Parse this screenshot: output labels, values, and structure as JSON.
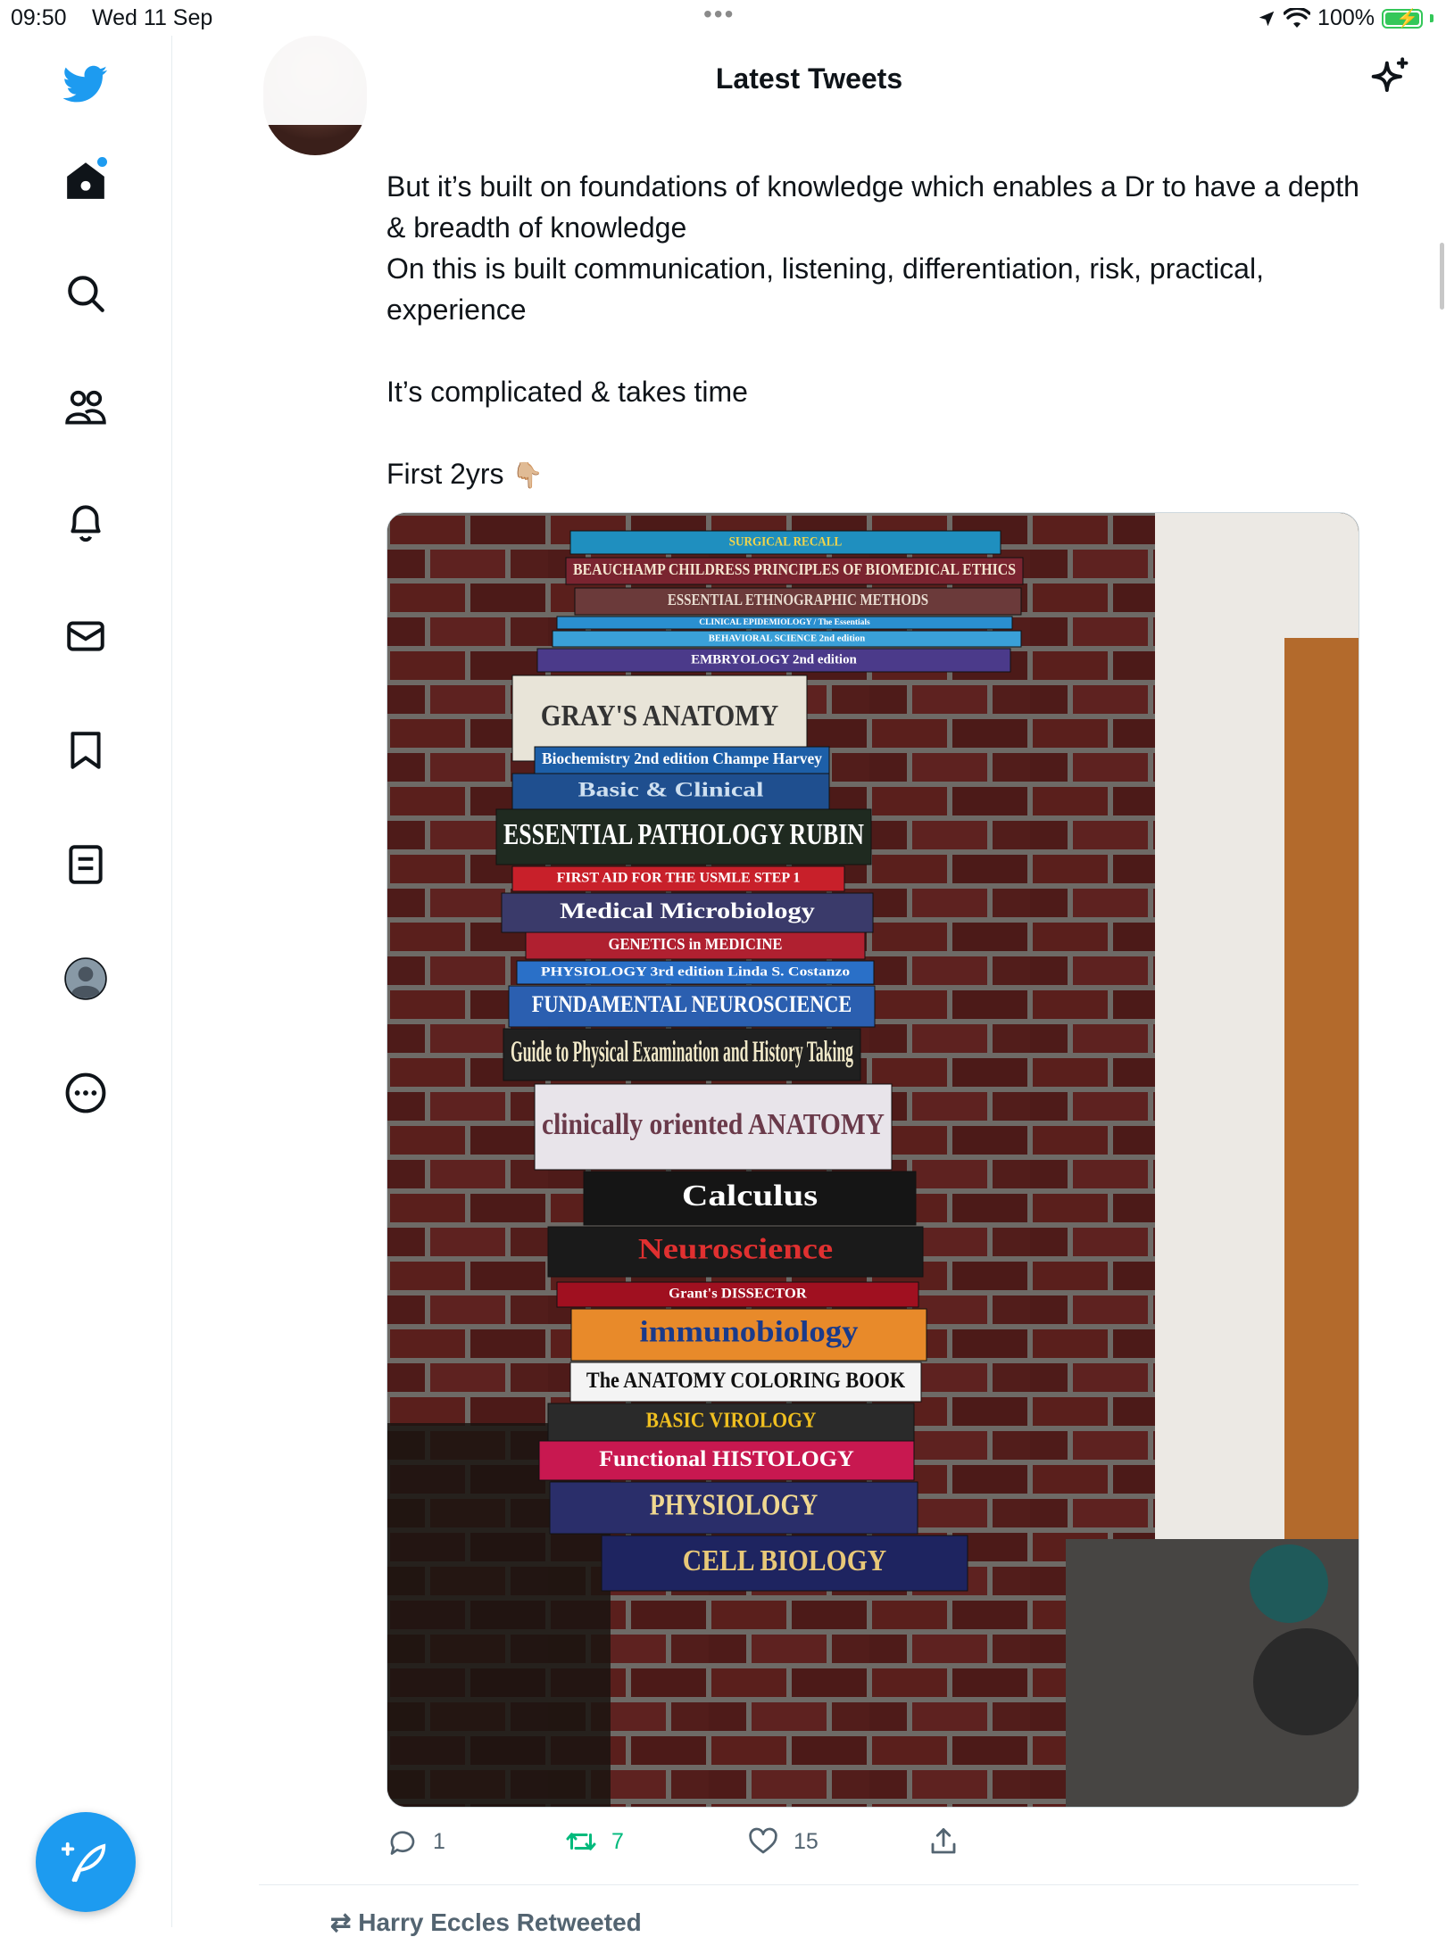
{
  "status_bar": {
    "time": "09:50",
    "date": "Wed 11 Sep",
    "battery": "100%"
  },
  "header": {
    "title": "Latest Tweets"
  },
  "tweet": {
    "text": "But it’s built on foundations of knowledge which enables a Dr to have a depth & breadth of knowledge\nOn this is built communication, listening, differentiation, risk, practical, experience\n\nIt’s complicated & takes time\n\nFirst 2yrs ",
    "emoji": "👇🏼",
    "reply_count": "1",
    "retweet_count": "7",
    "like_count": "15"
  },
  "books": [
    {
      "title": "SURGICAL RECALL",
      "color": "#1f8fbf",
      "text_color": "#f2d44a"
    },
    {
      "title": "BEAUCHAMP CHILDRESS  PRINCIPLES OF BIOMEDICAL ETHICS",
      "color": "#7a2430",
      "text_color": "#f4e6d0"
    },
    {
      "title": "ESSENTIAL ETHNOGRAPHIC METHODS",
      "color": "#6b3a3a",
      "text_color": "#e8dcd0"
    },
    {
      "title": "CLINICAL EPIDEMIOLOGY / The Essentials",
      "color": "#2a8fd0",
      "text_color": "#ffffff"
    },
    {
      "title": "BEHAVIORAL SCIENCE 2nd edition",
      "color": "#3aa0d8",
      "text_color": "#ffffff"
    },
    {
      "title": "EMBRYOLOGY 2nd edition",
      "color": "#4b3a8a",
      "text_color": "#ffffff"
    },
    {
      "title": "GRAY'S ANATOMY",
      "color": "#e8e4d8",
      "text_color": "#333333"
    },
    {
      "title": "Biochemistry 2nd edition  Champe Harvey",
      "color": "#1d5fa8",
      "text_color": "#ffffff"
    },
    {
      "title": "Basic & Clinical",
      "color": "#1f4f8f",
      "text_color": "#cfe0f0"
    },
    {
      "title": "ESSENTIAL PATHOLOGY  RUBIN",
      "color": "#1f2a20",
      "text_color": "#ffffff"
    },
    {
      "title": "FIRST AID FOR THE USMLE STEP 1",
      "color": "#c8202a",
      "text_color": "#ffffff"
    },
    {
      "title": "Medical Microbiology",
      "color": "#3a3a6a",
      "text_color": "#ffffff"
    },
    {
      "title": "GENETICS in MEDICINE",
      "color": "#b02030",
      "text_color": "#ffffff"
    },
    {
      "title": "PHYSIOLOGY 3rd edition  Linda S. Costanzo",
      "color": "#2a70c8",
      "text_color": "#ffffff"
    },
    {
      "title": "FUNDAMENTAL NEUROSCIENCE",
      "color": "#2b5fb0",
      "text_color": "#ffffff"
    },
    {
      "title": "Guide to Physical Examination and History Taking",
      "color": "#202020",
      "text_color": "#f0e8c8"
    },
    {
      "title": "clinically oriented ANATOMY",
      "color": "#e8e4ea",
      "text_color": "#6a3a4a"
    },
    {
      "title": "Calculus",
      "color": "#151515",
      "text_color": "#ffffff"
    },
    {
      "title": "Neuroscience",
      "color": "#1a1a1a",
      "text_color": "#e03030"
    },
    {
      "title": "Grant's DISSECTOR",
      "color": "#a01020",
      "text_color": "#ffffff"
    },
    {
      "title": "immunobiology",
      "color": "#e88a2a",
      "text_color": "#1a3a8a"
    },
    {
      "title": "The ANATOMY COLORING BOOK",
      "color": "#f4f4f4",
      "text_color": "#111111"
    },
    {
      "title": "BASIC VIROLOGY",
      "color": "#2a2a2a",
      "text_color": "#f0c020"
    },
    {
      "title": "Functional HISTOLOGY",
      "color": "#c81850",
      "text_color": "#ffffff"
    },
    {
      "title": "PHYSIOLOGY",
      "color": "#2a2e6a",
      "text_color": "#f0d890"
    },
    {
      "title": "CELL BIOLOGY",
      "color": "#1e2460",
      "text_color": "#e8c878"
    }
  ],
  "next": {
    "retweet_label": "Harry Eccles Retweeted"
  }
}
